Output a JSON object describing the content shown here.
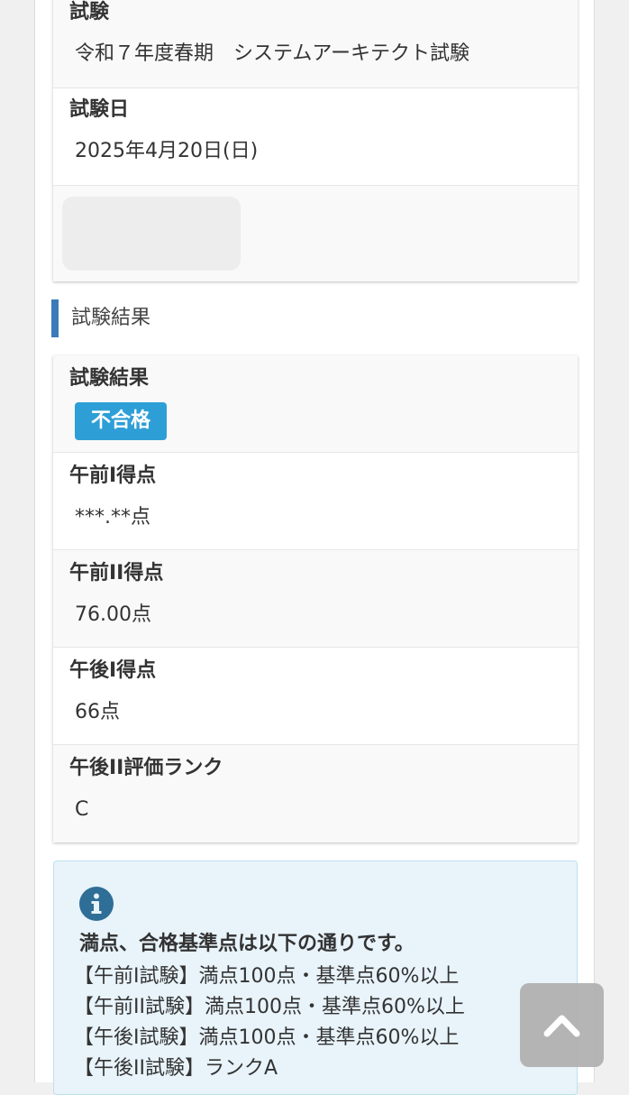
{
  "exam_info": {
    "exam_label": "試験",
    "exam_value": "令和７年度春期　システムアーキテクト試験",
    "date_label": "試験日",
    "date_value": "2025年4月20日(日)"
  },
  "results_section": {
    "heading": "試験結果",
    "result_label": "試験結果",
    "result_badge": "不合格",
    "rows": [
      {
        "label": "午前I得点",
        "value": "***.**点"
      },
      {
        "label": "午前II得点",
        "value": "76.00点"
      },
      {
        "label": "午後I得点",
        "value": "66点"
      },
      {
        "label": "午後II評価ランク",
        "value": "C"
      }
    ]
  },
  "info": {
    "icon": "info-circle-icon",
    "title": "満点、合格基準点は以下の通りです。",
    "lines": [
      "【午前I試験】満点100点・基準点60%以上",
      "【午前II試験】満点100点・基準点60%以上",
      "【午後I試験】満点100点・基準点60%以上",
      "【午後II試験】ランクA"
    ]
  },
  "colors": {
    "accent_bar": "#3a7ab8",
    "badge_bg": "#2e9fd6",
    "info_bg": "#e8f3fa",
    "info_icon": "#2f6e96"
  }
}
